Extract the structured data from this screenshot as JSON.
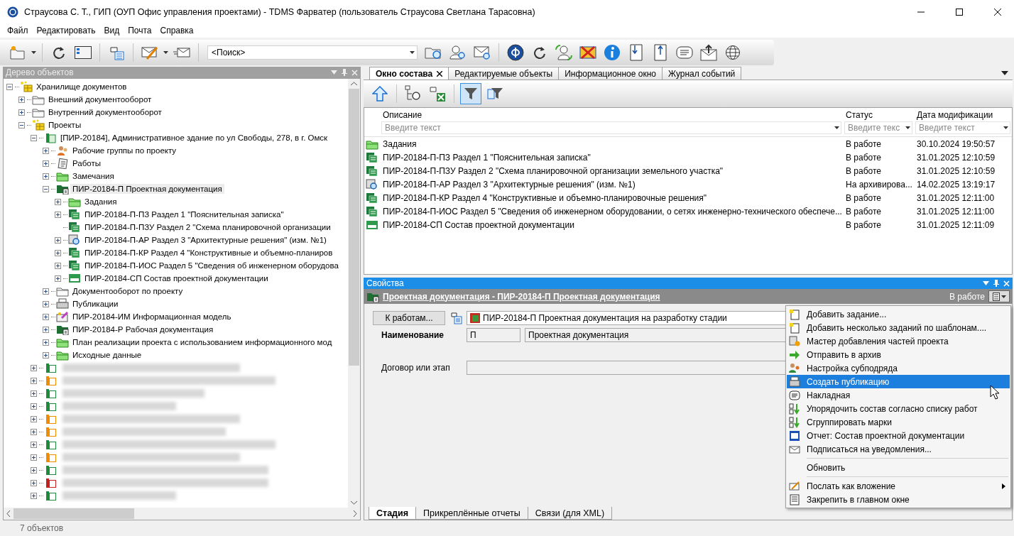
{
  "window": {
    "title": "Страусова С. Т., ГИП (ОУП Офис управления проектами) - TDMS Фарватер (пользователь Страусова Светлана Тарасовна)"
  },
  "menu": [
    "Файл",
    "Редактировать",
    "Вид",
    "Почта",
    "Справка"
  ],
  "search": {
    "value": "<Поиск>"
  },
  "tree_panel": {
    "title": "Дерево объектов",
    "tree": [
      {
        "label": "Хранилище документов",
        "kind": "storage",
        "has_children": true,
        "expanded": true,
        "selected": false,
        "children": [
          {
            "label": "Внешний документооборот",
            "kind": "folder",
            "has_children": true,
            "expanded": false,
            "selected": false
          },
          {
            "label": "Внутренний документооборот",
            "kind": "folder",
            "has_children": true,
            "expanded": false,
            "selected": false
          },
          {
            "label": "Проекты",
            "kind": "storage",
            "has_children": true,
            "expanded": true,
            "selected": false,
            "children": [
              {
                "label": "[ПИР-20184], Административное здание по ул Свободы, 278, в г. Омск",
                "kind": "project",
                "color": "#1e8a3c",
                "has_children": true,
                "expanded": true,
                "selected": false,
                "children": [
                  {
                    "label": "Рабочие группы по проекту",
                    "kind": "people",
                    "has_children": true,
                    "expanded": false,
                    "selected": false
                  },
                  {
                    "label": "Работы",
                    "kind": "works",
                    "has_children": true,
                    "expanded": false,
                    "selected": false
                  },
                  {
                    "label": "Замечания",
                    "kind": "green-folder",
                    "has_children": true,
                    "expanded": false,
                    "selected": false
                  },
                  {
                    "label": "ПИР-20184-П Проектная документация",
                    "kind": "doc-folder",
                    "has_children": true,
                    "expanded": true,
                    "selected": true,
                    "children": [
                      {
                        "label": "Задания",
                        "kind": "green-folder",
                        "has_children": true,
                        "expanded": false,
                        "selected": false
                      },
                      {
                        "label": "ПИР-20184-П-ПЗ Раздел 1 \"Пояснительная записка\"",
                        "kind": "section",
                        "has_children": true,
                        "expanded": false,
                        "selected": false
                      },
                      {
                        "label": "ПИР-20184-П-ПЗУ Раздел 2 \"Схема планировочной организации",
                        "kind": "section",
                        "has_children": false,
                        "expanded": false,
                        "selected": false
                      },
                      {
                        "label": "ПИР-20184-П-АР Раздел 3 \"Архитектурные решения\" (изм. №1)",
                        "kind": "section-review",
                        "has_children": true,
                        "expanded": false,
                        "selected": false
                      },
                      {
                        "label": "ПИР-20184-П-КР Раздел 4 \"Конструктивные и объемно-планиров",
                        "kind": "section",
                        "has_children": true,
                        "expanded": false,
                        "selected": false
                      },
                      {
                        "label": "ПИР-20184-П-ИОС Раздел 5 \"Сведения об инженерном оборудова",
                        "kind": "section",
                        "has_children": true,
                        "expanded": false,
                        "selected": false
                      },
                      {
                        "label": "ПИР-20184-СП Состав проектной документации",
                        "kind": "list",
                        "has_children": true,
                        "expanded": false,
                        "selected": false
                      }
                    ]
                  },
                  {
                    "label": "Документооборот по проекту",
                    "kind": "folder",
                    "has_children": true,
                    "expanded": false,
                    "selected": false
                  },
                  {
                    "label": "Публикации",
                    "kind": "printer",
                    "has_children": true,
                    "expanded": false,
                    "selected": false
                  },
                  {
                    "label": "ПИР-20184-ИМ Информационная модель",
                    "kind": "model",
                    "has_children": true,
                    "expanded": false,
                    "selected": false
                  },
                  {
                    "label": "ПИР-20184-Р Рабочая документация",
                    "kind": "doc-folder",
                    "has_children": true,
                    "expanded": false,
                    "selected": false
                  },
                  {
                    "label": "План реализации проекта с использованием информационного мод",
                    "kind": "green-folder",
                    "has_children": true,
                    "expanded": false,
                    "selected": false
                  },
                  {
                    "label": "Исходные данные",
                    "kind": "green-folder",
                    "has_children": true,
                    "expanded": false,
                    "selected": false
                  }
                ]
              },
              {
                "kind": "redacted",
                "color": "#1e8a3c",
                "has_children": true,
                "expanded": false,
                "selected": false
              },
              {
                "kind": "redacted",
                "color": "#f08c00",
                "has_children": true,
                "expanded": false,
                "selected": false
              },
              {
                "kind": "redacted",
                "color": "#1e8a3c",
                "has_children": true,
                "expanded": false,
                "selected": false
              },
              {
                "kind": "redacted",
                "color": "#1e8a3c",
                "has_children": true,
                "expanded": false,
                "selected": false
              },
              {
                "kind": "redacted",
                "color": "#f08c00",
                "has_children": true,
                "expanded": false,
                "selected": false
              },
              {
                "kind": "redacted",
                "color": "#f08c00",
                "has_children": true,
                "expanded": false,
                "selected": false
              },
              {
                "kind": "redacted",
                "color": "#1e8a3c",
                "has_children": true,
                "expanded": false,
                "selected": false
              },
              {
                "kind": "redacted",
                "color": "#f08c00",
                "has_children": true,
                "expanded": false,
                "selected": false
              },
              {
                "kind": "redacted",
                "color": "#1e8a3c",
                "has_children": true,
                "expanded": false,
                "selected": false
              },
              {
                "kind": "redacted",
                "color": "#c81e1e",
                "has_children": true,
                "expanded": false,
                "selected": false
              },
              {
                "kind": "redacted",
                "color": "#1e8a3c",
                "has_children": true,
                "expanded": false,
                "selected": false
              }
            ]
          }
        ]
      }
    ]
  },
  "tabs": [
    {
      "label": "Окно состава",
      "selected": true,
      "closable": true
    },
    {
      "label": "Редактируемые объекты",
      "selected": false,
      "closable": false
    },
    {
      "label": "Информационное окно",
      "selected": false,
      "closable": false
    },
    {
      "label": "Журнал событий",
      "selected": false,
      "closable": false
    }
  ],
  "composition_toolbar": {
    "filter_on": true
  },
  "table": {
    "columns": [
      {
        "label": "Описание",
        "placeholder": "Введите текст"
      },
      {
        "label": "Статус",
        "placeholder": "Введите текс"
      },
      {
        "label": "Дата модификации",
        "placeholder": "Введите текст"
      }
    ],
    "rows": [
      {
        "kind": "green-folder",
        "description": "Задания",
        "status": "В работе",
        "date": "30.10.2024 19:50:57"
      },
      {
        "kind": "section",
        "description": "ПИР-20184-П-ПЗ Раздел 1 \"Пояснительная записка\"",
        "status": "В работе",
        "date": "31.01.2025 12:10:59"
      },
      {
        "kind": "section",
        "description": "ПИР-20184-П-ПЗУ Раздел 2 \"Схема планировочной организации земельного участка\"",
        "status": "В работе",
        "date": "31.01.2025 12:10:59"
      },
      {
        "kind": "section-review",
        "description": "ПИР-20184-П-АР Раздел 3 \"Архитектурные решения\" (изм. №1)",
        "status": "На архивирова...",
        "date": "14.02.2025 13:19:17"
      },
      {
        "kind": "section",
        "description": "ПИР-20184-П-КР Раздел 4 \"Конструктивные и объемно-планировочные решения\"",
        "status": "В работе",
        "date": "31.01.2025 12:11:00"
      },
      {
        "kind": "section",
        "description": "ПИР-20184-П-ИОС Раздел 5 \"Сведения об инженерном оборудовании, о сетях инженерно-технического обеспече...",
        "status": "В работе",
        "date": "31.01.2025 12:11:00"
      },
      {
        "kind": "list",
        "description": "ПИР-20184-СП Состав проектной документации",
        "status": "В работе",
        "date": "31.01.2025 12:11:09"
      }
    ]
  },
  "properties": {
    "title": "Свойства",
    "object_link": "Проектная документация - ПИР-20184-П Проектная документация",
    "object_status": "В работе",
    "to_works_button": "К работам...",
    "stage": "ПИР-20184-П Проектная документация на разработку стадии",
    "name_label": "Наименование",
    "name_code": "П",
    "name_value": "Проектная документация",
    "contract_label": "Договор или этап",
    "tabs": [
      {
        "label": "Стадия",
        "selected": true
      },
      {
        "label": "Прикреплённые отчеты",
        "selected": false
      },
      {
        "label": "Связи (для XML)",
        "selected": false
      }
    ]
  },
  "context_menu": [
    {
      "label": "Добавить задание...",
      "kind": "task",
      "selected": false,
      "separator_before": false,
      "submenu": false
    },
    {
      "label": "Добавить несколько заданий по шаблонам....",
      "kind": "task",
      "selected": false,
      "separator_before": false,
      "submenu": false
    },
    {
      "label": "Мастер добавления частей проекта",
      "kind": "wizard",
      "selected": false,
      "separator_before": false,
      "submenu": false
    },
    {
      "label": "Отправить в архив",
      "kind": "arrow",
      "selected": false,
      "separator_before": false,
      "submenu": false
    },
    {
      "label": "Настройка субподряда",
      "kind": "people",
      "selected": false,
      "separator_before": false,
      "submenu": false
    },
    {
      "label": "Создать публикацию",
      "kind": "printer",
      "selected": true,
      "separator_before": false,
      "submenu": false
    },
    {
      "label": "Накладная",
      "kind": "note",
      "selected": false,
      "separator_before": false,
      "submenu": false
    },
    {
      "label": "Упорядочить состав согласно списку работ",
      "kind": "sort",
      "selected": false,
      "separator_before": false,
      "submenu": false
    },
    {
      "label": "Сгруппировать марки",
      "kind": "sort",
      "selected": false,
      "separator_before": false,
      "submenu": false
    },
    {
      "label": "Отчет: Состав проектной документации",
      "kind": "word",
      "selected": false,
      "separator_before": false,
      "submenu": false
    },
    {
      "label": "Подписаться на уведомления...",
      "kind": "mail",
      "selected": false,
      "separator_before": false,
      "submenu": false
    },
    {
      "label": "Обновить",
      "kind": "plain",
      "selected": false,
      "separator_before": true,
      "submenu": false
    },
    {
      "label": "Послать как вложение",
      "kind": "mail-pen",
      "selected": false,
      "separator_before": true,
      "submenu": true
    },
    {
      "label": "Закрепить в главном окне",
      "kind": "pin",
      "selected": false,
      "separator_before": false,
      "submenu": false
    }
  ],
  "status_bar": "7 объектов"
}
